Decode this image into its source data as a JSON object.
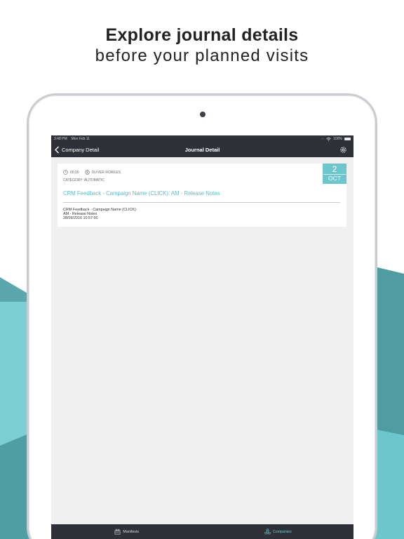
{
  "marketing": {
    "headline": "Explore journal details",
    "subheadline": "before your planned visits"
  },
  "status_bar": {
    "time": "3:48 PM",
    "date": "Mon Feb 11",
    "battery": "100%"
  },
  "nav": {
    "back_label": "Company Detail",
    "title": "Journal Detail"
  },
  "journal_entry": {
    "time": "00:00",
    "user": "OLIVER ROWLES",
    "category_label": "CATEGORY:",
    "category_value": "AUTOMATIC",
    "title": "CRM Feedback - Campaign Name (CLICK): AM - Release Notes",
    "body_line1": "CRM Feedback - Campaign Name (CLICK):",
    "body_line2": "AM - Release Notes",
    "body_line3": "28/09/2016 10:57:00",
    "date_day": "2",
    "date_month": "OCT"
  },
  "tabs": [
    {
      "label": "Manifests",
      "icon": "manifests-icon",
      "active": false
    },
    {
      "label": "Companies",
      "icon": "companies-icon",
      "active": true
    }
  ],
  "colors": {
    "accent": "#6cc6cb",
    "bar": "#2e3238",
    "teal_dark": "#4f9ca1"
  }
}
